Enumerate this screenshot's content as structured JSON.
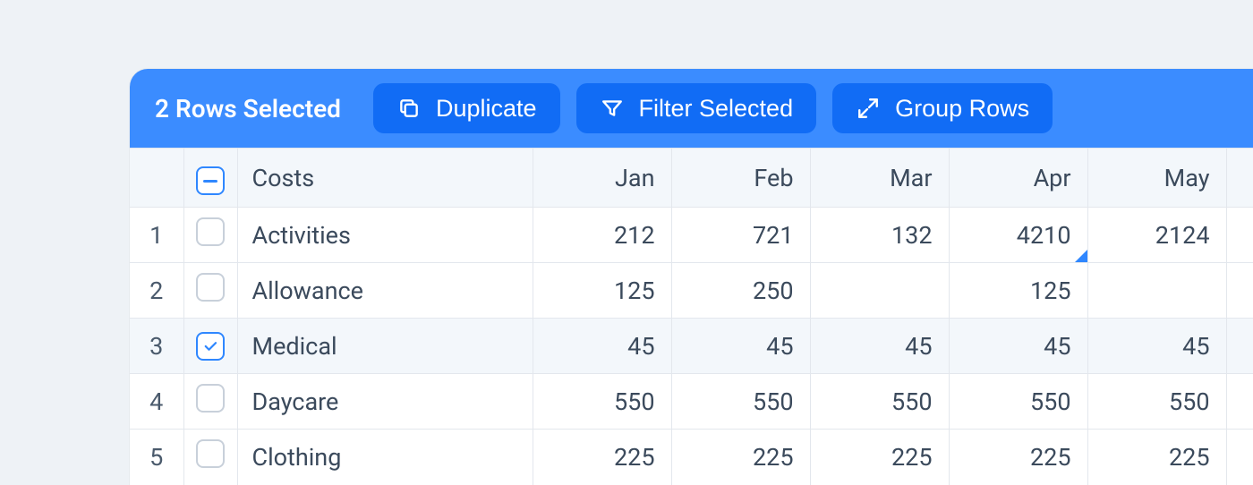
{
  "toolbar": {
    "selection_label": "2 Rows Selected",
    "duplicate_label": "Duplicate",
    "filter_label": "Filter Selected",
    "group_label": "Group Rows"
  },
  "table": {
    "header": {
      "name": "Costs",
      "months": [
        "Jan",
        "Feb",
        "Mar",
        "Apr",
        "May"
      ]
    },
    "rows": [
      {
        "num": "1",
        "selected": false,
        "name": "Activities",
        "vals": [
          "212",
          "721",
          "132",
          "4210",
          "2124"
        ],
        "marker_col": 3
      },
      {
        "num": "2",
        "selected": false,
        "name": "Allowance",
        "vals": [
          "125",
          "250",
          "",
          "125",
          ""
        ]
      },
      {
        "num": "3",
        "selected": true,
        "name": "Medical",
        "vals": [
          "45",
          "45",
          "45",
          "45",
          "45"
        ]
      },
      {
        "num": "4",
        "selected": false,
        "name": "Daycare",
        "vals": [
          "550",
          "550",
          "550",
          "550",
          "550"
        ]
      },
      {
        "num": "5",
        "selected": false,
        "name": "Clothing",
        "vals": [
          "225",
          "225",
          "225",
          "225",
          "225"
        ]
      }
    ],
    "header_checkbox_state": "indeterminate"
  }
}
